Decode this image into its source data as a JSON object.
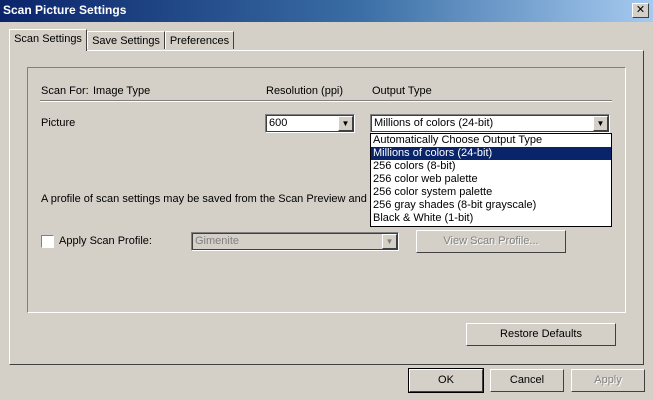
{
  "window": {
    "title": "Scan Picture Settings",
    "close_glyph": "✕"
  },
  "tabs": [
    {
      "label": "Scan Settings",
      "active": true
    },
    {
      "label": "Save Settings",
      "active": false
    },
    {
      "label": "Preferences",
      "active": false
    }
  ],
  "headers": {
    "scan_for": "Scan For:",
    "image_type": "Image Type",
    "resolution": "Resolution (ppi)",
    "output_type": "Output Type"
  },
  "row": {
    "image_type": "Picture",
    "resolution_value": "600",
    "output_value": "Millions of colors (24-bit)"
  },
  "output_options": [
    {
      "label": "Automatically Choose Output Type",
      "selected": false
    },
    {
      "label": "Millions of colors (24-bit)",
      "selected": true
    },
    {
      "label": "256 colors (8-bit)",
      "selected": false
    },
    {
      "label": "256 color web palette",
      "selected": false
    },
    {
      "label": "256 color system palette",
      "selected": false
    },
    {
      "label": "256 gray shades (8-bit grayscale)",
      "selected": false
    },
    {
      "label": "Black & White (1-bit)",
      "selected": false
    }
  ],
  "profile_note": "A profile of scan settings may be saved from the Scan Preview and ch",
  "apply_profile": {
    "label": "Apply Scan Profile:",
    "checked": false,
    "profile_value": "Gimenite",
    "view_button": "View Scan Profile..."
  },
  "buttons": {
    "restore": "Restore Defaults",
    "ok": "OK",
    "cancel": "Cancel",
    "apply": "Apply"
  },
  "icons": {
    "dropdown_arrow": "▼"
  },
  "colors": {
    "titlebar_start": "#0a246a",
    "titlebar_end": "#a6caf0",
    "selection": "#0a246a",
    "face": "#d4d0c8"
  }
}
